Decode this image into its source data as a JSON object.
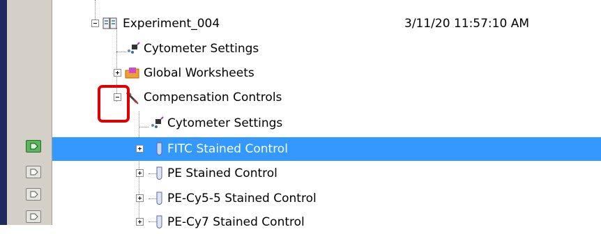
{
  "tree": {
    "root": {
      "label": "Experiment_004",
      "date": "3/11/20 11:57:10 AM"
    },
    "items": [
      {
        "label": "Cytometer Settings"
      },
      {
        "label": "Global Worksheets"
      },
      {
        "label": "Compensation Controls"
      },
      {
        "label": "Cytometer Settings"
      },
      {
        "label": "FITC Stained Control"
      },
      {
        "label": "PE Stained Control"
      },
      {
        "label": "PE-Cy5-5 Stained Control"
      },
      {
        "label": "PE-Cy7 Stained Control"
      }
    ]
  },
  "colors": {
    "selection": "#3399ff",
    "highlight": "#e00000",
    "acquire_active": "#5ab65a"
  },
  "icons": {
    "experiment": "book-icon",
    "settings": "cytometer-settings-icon",
    "worksheets": "folder-icon",
    "compensation": "pipette-icon",
    "tube": "tube-icon",
    "acquire": "acquisition-pointer-icon"
  }
}
